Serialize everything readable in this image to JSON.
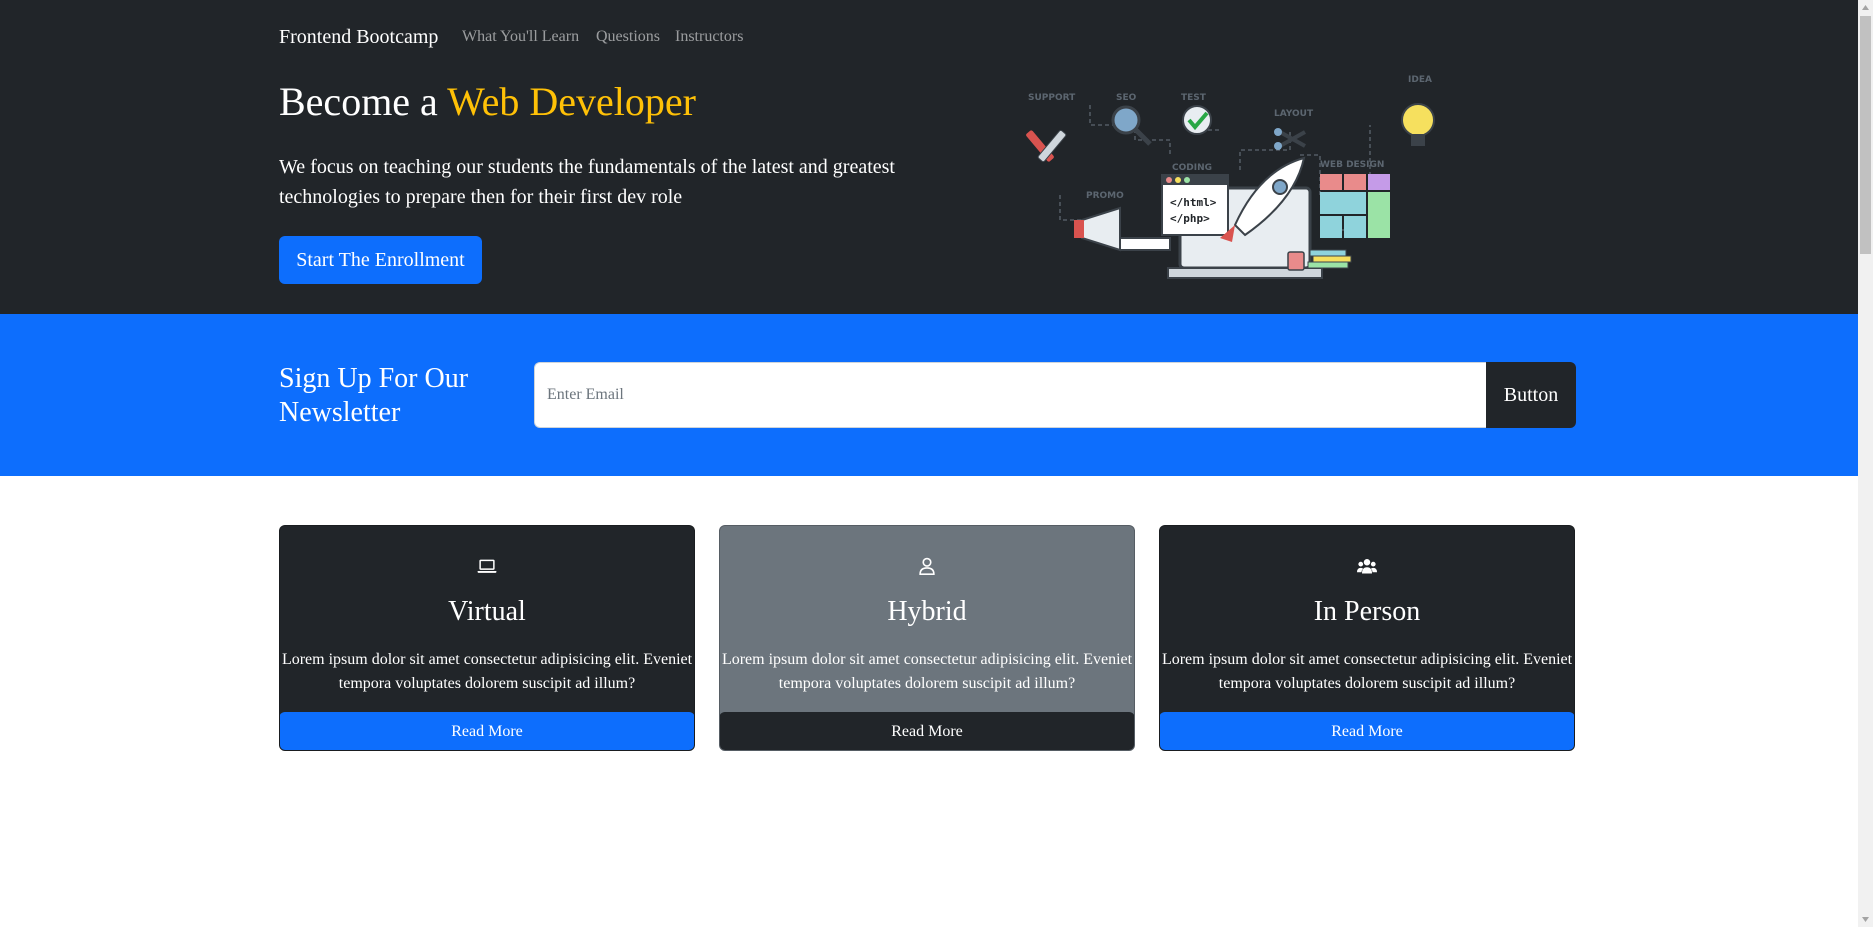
{
  "navbar": {
    "brand": "Frontend Bootcamp",
    "links": [
      "What You'll Learn",
      "Questions",
      "Instructors"
    ]
  },
  "hero": {
    "title_prefix": "Become a ",
    "title_accent": "Web Developer",
    "lead": "We focus on teaching our students the fundamentals of the latest and greatest technologies to prepare then for their first dev role",
    "button": "Start The Enrollment",
    "illustration": {
      "labels": [
        "SUPPORT",
        "SEO",
        "TEST",
        "LAYOUT",
        "IDEA",
        "CODING",
        "WEB DESIGN",
        "PROMO"
      ],
      "code_lines": [
        "</html>",
        "</php>"
      ]
    }
  },
  "newsletter": {
    "title": "Sign Up For Our Newsletter",
    "placeholder": "Enter Email",
    "button": "Button"
  },
  "cards": [
    {
      "icon": "laptop-icon",
      "title": "Virtual",
      "text": "Lorem ipsum dolor sit amet consectetur adipisicing elit. Eveniet tempora voluptates dolorem suscipit ad illum?",
      "button": "Read More"
    },
    {
      "icon": "person-icon",
      "title": "Hybrid",
      "text": "Lorem ipsum dolor sit amet consectetur adipisicing elit. Eveniet tempora voluptates dolorem suscipit ad illum?",
      "button": "Read More"
    },
    {
      "icon": "people-icon",
      "title": "In Person",
      "text": "Lorem ipsum dolor sit amet consectetur adipisicing elit. Eveniet tempora voluptates dolorem suscipit ad illum?",
      "button": "Read More"
    }
  ],
  "colors": {
    "dark": "#212529",
    "primary": "#0d6efd",
    "accent": "#ffc107",
    "secondary": "#6c757d"
  }
}
